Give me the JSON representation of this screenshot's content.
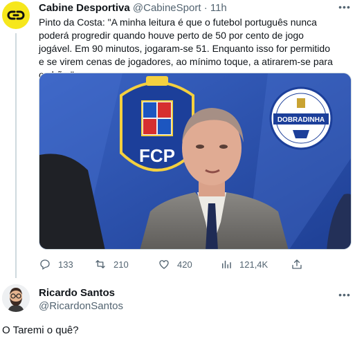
{
  "tweet": {
    "author_name": "Cabine Desportiva",
    "handle": "@CabineSport",
    "separator": "·",
    "time": "11h",
    "text": "Pinto da Costa: \"A minha leitura é que o futebol português nunca poderá progredir quando houve perto de 50 por cento de jogo jogável. Em 90 minutos, jogaram-se  51. Enquanto isso for permitido e se virem cenas de jogadores, ao mínimo toque, a atirarem-se para o chão.\"",
    "media": {
      "crest_letters": "FCP",
      "badge_text": "DOBRADINHA"
    },
    "actions": {
      "replies": "133",
      "retweets": "210",
      "likes": "420",
      "views": "121,4K"
    }
  },
  "reply": {
    "author_name": "Ricardo Santos",
    "handle": "@RicardonSantos",
    "text": "O Taremi o quê?"
  },
  "colors": {
    "avatar_yellow": "#f6e71c",
    "text_primary": "#0f1419",
    "text_secondary": "#536471",
    "thread_line": "#cfd9de"
  }
}
